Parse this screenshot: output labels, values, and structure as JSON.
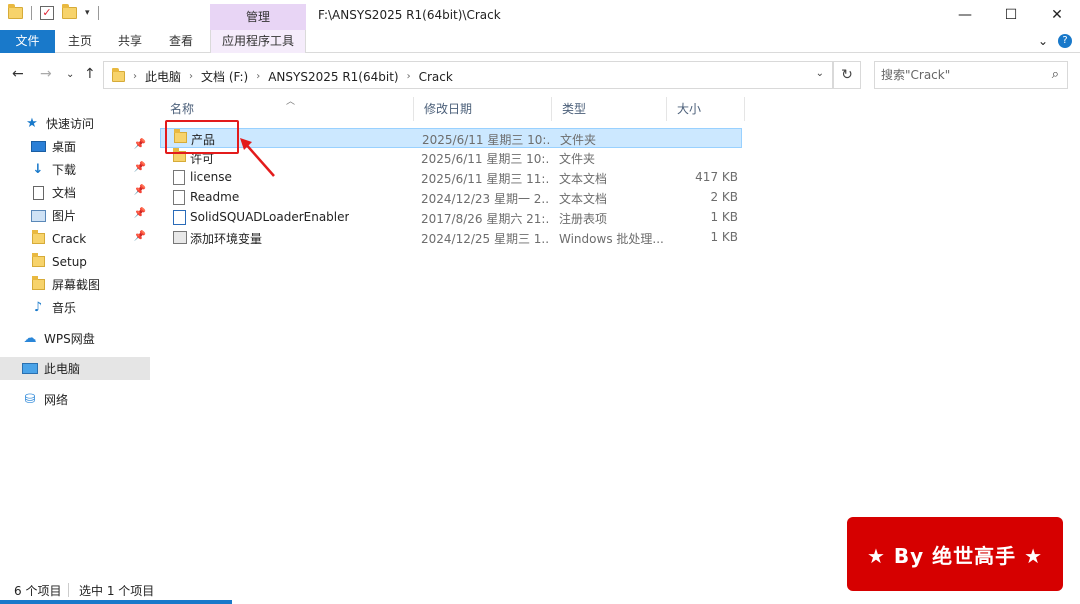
{
  "titlebar": {
    "path": "F:\\ANSYS2025 R1(64bit)\\Crack",
    "manage_tab": "管理",
    "minimize": "—",
    "maximize": "☐",
    "close": "✕"
  },
  "ribbon": {
    "tabs": [
      "文件",
      "主页",
      "共享",
      "查看",
      "应用程序工具"
    ],
    "collapse": "⌄",
    "help": "?"
  },
  "address": {
    "back": "←",
    "forward": "→",
    "history": "⌄",
    "up": "↑",
    "crumbs": [
      "此电脑",
      "文档 (F:)",
      "ANSYS2025 R1(64bit)",
      "Crack"
    ],
    "dropdown": "⌄",
    "refresh": "↻"
  },
  "search": {
    "placeholder": "搜索\"Crack\"",
    "icon": "search-icon"
  },
  "sidebar": {
    "items": [
      {
        "label": "快速访问",
        "icon": "star-icon"
      },
      {
        "label": "桌面",
        "icon": "desktop-icon",
        "pinned": true
      },
      {
        "label": "下载",
        "icon": "download-icon",
        "pinned": true
      },
      {
        "label": "文档",
        "icon": "document-icon",
        "pinned": true
      },
      {
        "label": "图片",
        "icon": "picture-icon",
        "pinned": true
      },
      {
        "label": "Crack",
        "icon": "folder-icon",
        "pinned": true
      },
      {
        "label": "Setup",
        "icon": "folder-icon"
      },
      {
        "label": "屏幕截图",
        "icon": "folder-icon"
      },
      {
        "label": "音乐",
        "icon": "music-icon"
      },
      {
        "label": "WPS网盘",
        "icon": "cloud-icon"
      },
      {
        "label": "此电脑",
        "icon": "computer-icon",
        "selected": true
      },
      {
        "label": "网络",
        "icon": "network-icon"
      }
    ]
  },
  "columns": {
    "name": "名称",
    "date": "修改日期",
    "type": "类型",
    "size": "大小"
  },
  "files": [
    {
      "name": "产品",
      "date": "2025/6/11 星期三 10:...",
      "type": "文件夹",
      "size": "",
      "icon": "folder-icon",
      "selected": true
    },
    {
      "name": "许可",
      "date": "2025/6/11 星期三 10:...",
      "type": "文件夹",
      "size": "",
      "icon": "folder-icon"
    },
    {
      "name": "license",
      "date": "2025/6/11 星期三 11:...",
      "type": "文本文档",
      "size": "417 KB",
      "icon": "text-file-icon"
    },
    {
      "name": "Readme",
      "date": "2024/12/23 星期一 2...",
      "type": "文本文档",
      "size": "2 KB",
      "icon": "text-file-icon"
    },
    {
      "name": "SolidSQUADLoaderEnabler",
      "date": "2017/8/26 星期六 21:...",
      "type": "注册表项",
      "size": "1 KB",
      "icon": "registry-file-icon"
    },
    {
      "name": "添加环境变量",
      "date": "2024/12/25 星期三 1...",
      "type": "Windows 批处理...",
      "size": "1 KB",
      "icon": "batch-file-icon"
    }
  ],
  "status": {
    "count": "6 个项目",
    "selected": "选中 1 个项目"
  },
  "stamp": {
    "text": "★ By 绝世高手 ★"
  },
  "colors": {
    "accent": "#1979ca",
    "selection": "#cce8ff",
    "highlight": "#e31b1b",
    "stamp": "#d60000"
  }
}
